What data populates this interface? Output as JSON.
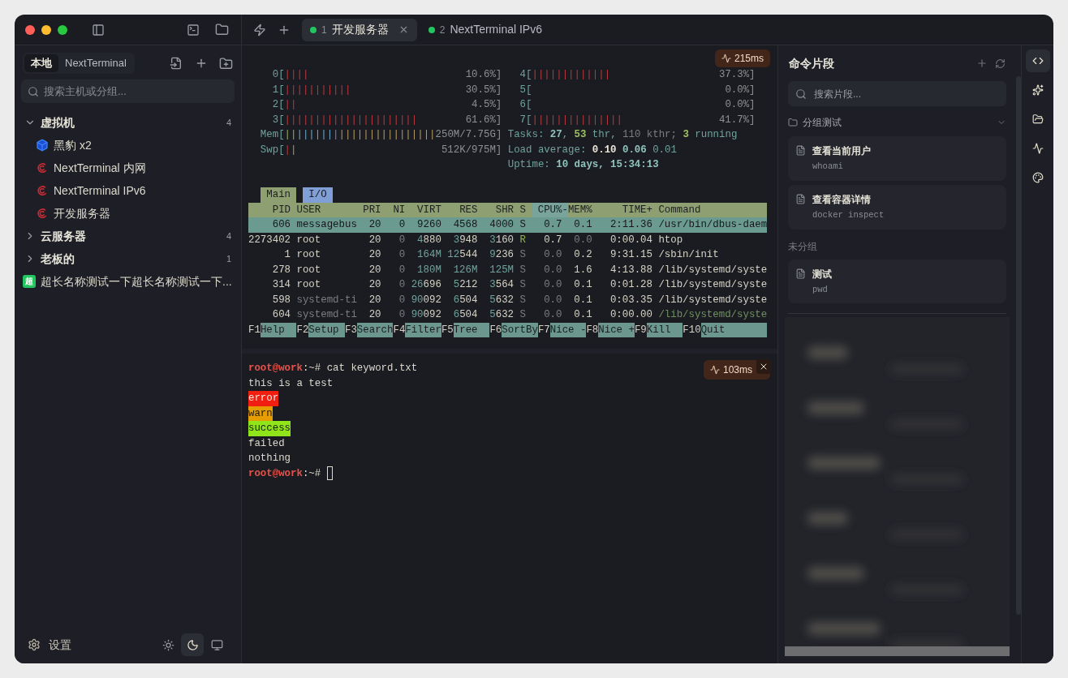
{
  "titlebar": {
    "tabs": [
      {
        "number": "1",
        "title": "开发服务器",
        "selected": true,
        "connected": true
      },
      {
        "number": "2",
        "title": "NextTerminal IPv6",
        "selected": false,
        "connected": true
      }
    ]
  },
  "sidebar": {
    "tabs": [
      {
        "label": "本地",
        "selected": true
      },
      {
        "label": "NextTerminal",
        "selected": false
      }
    ],
    "search": {
      "placeholder": "搜索主机或分组..."
    },
    "items": [
      {
        "kind": "group",
        "name": "虚拟机",
        "count": "4",
        "expanded": true,
        "children": [
          {
            "kind": "cube",
            "name": "黑豹 x2"
          },
          {
            "kind": "debian",
            "name": "NextTerminal 内网"
          },
          {
            "kind": "debian",
            "name": "NextTerminal IPv6"
          },
          {
            "kind": "debian",
            "name": "开发服务器"
          }
        ]
      },
      {
        "kind": "group",
        "name": "云服务器",
        "count": "4",
        "expanded": false
      },
      {
        "kind": "group",
        "name": "老板的",
        "count": "1",
        "expanded": false
      },
      {
        "kind": "badge",
        "badge": "超",
        "name": "超长名称测试一下超长名称测试一下..."
      }
    ],
    "settings": "设置",
    "themes": [
      {
        "kind": "light",
        "selected": false
      },
      {
        "kind": "dark",
        "selected": true
      },
      {
        "kind": "system",
        "selected": false
      }
    ]
  },
  "htop": {
    "latency": "215ms",
    "meters": [
      {
        "left": {
          "label": "0[",
          "bars": [
            {
              "text": "||||",
              "kind": "r"
            }
          ],
          "value": "10.6%]"
        },
        "right": {
          "label": "4[",
          "bars": [
            {
              "text": "|||||||||||||",
              "kind": "r"
            }
          ],
          "value": "37.3%]"
        }
      },
      {
        "left": {
          "label": "1[",
          "bars": [
            {
              "text": "|||||||||||",
              "kind": "r"
            }
          ],
          "value": "30.5%]"
        },
        "right": {
          "label": "5[",
          "value": "0.0%]"
        }
      },
      {
        "left": {
          "label": "2[",
          "bars": [
            {
              "text": "||",
              "kind": "r"
            }
          ],
          "value": "4.5%]"
        },
        "right": {
          "label": "6[",
          "value": "0.0%]"
        }
      },
      {
        "left": {
          "label": "3[",
          "bars": [
            {
              "text": "||||||||||||||||||||||",
              "kind": "r"
            }
          ],
          "value": "61.6%]"
        },
        "right": {
          "label": "7[",
          "bars": [
            {
              "text": "|||||||||||||||",
              "kind": "r"
            }
          ],
          "value": "41.7%]"
        }
      },
      {
        "left": {
          "label": "Mem[",
          "bars": [
            {
              "text": "||",
              "kind": "g"
            },
            {
              "text": "||||||",
              "kind": "bl"
            },
            {
              "text": "|",
              "kind": "p"
            },
            {
              "text": "||||||||||||||||",
              "kind": "y"
            }
          ],
          "value": "250M/7.75G]"
        },
        "info": [
          {
            "text": "Tasks: ",
            "kind": "t"
          },
          {
            "text": "27",
            "kind": "tb"
          },
          {
            "text": ", ",
            "kind": "t"
          },
          {
            "text": "53",
            "kind": "gb"
          },
          {
            "text": " thr, ",
            "kind": "t"
          },
          {
            "text": "110",
            "kind": "d"
          },
          {
            "text": " kthr; ",
            "kind": "d"
          },
          {
            "text": "3",
            "kind": "gb"
          },
          {
            "text": " running",
            "kind": "t"
          }
        ]
      },
      {
        "left": {
          "label": "Swp[",
          "bars": [
            {
              "text": "|",
              "kind": "r"
            },
            {
              "text": "|",
              "kind": "y"
            }
          ],
          "value": "512K/975M]"
        },
        "info": [
          {
            "text": "Load average: ",
            "kind": "t"
          },
          {
            "text": "0.10",
            "kind": "w"
          },
          {
            "text": " 0.06",
            "kind": "tb"
          },
          {
            "text": " 0.01",
            "kind": "t"
          }
        ]
      },
      {
        "info": [
          {
            "text": "Uptime: ",
            "kind": "t"
          },
          {
            "text": "10 days, 15:34:13",
            "kind": "tb"
          }
        ]
      }
    ],
    "tabs": [
      {
        "label": "Main",
        "selected": true
      },
      {
        "label": "I/O",
        "selected": false
      }
    ],
    "columns": [
      {
        "label": "PID",
        "sorted": false
      },
      {
        "label": "USER",
        "sorted": false
      },
      {
        "label": "PRI",
        "sorted": false
      },
      {
        "label": "NI",
        "sorted": false
      },
      {
        "label": "VIRT",
        "sorted": false
      },
      {
        "label": "RES",
        "sorted": false
      },
      {
        "label": "SHR",
        "sorted": false
      },
      {
        "label": "S",
        "sorted": false
      },
      {
        "label": "CPU%-",
        "sorted": true
      },
      {
        "label": "MEM%",
        "sorted": false
      },
      {
        "label": "TIME+",
        "sorted": false
      },
      {
        "label": "Command",
        "sorted": false
      }
    ],
    "rows": [
      {
        "selected": true,
        "cells": [
          "606",
          "messagebus",
          "20",
          "0",
          "9260",
          "4568",
          "4000",
          "S",
          "0.7",
          "0.1",
          "2:11.36",
          "/usr/bin/dbus-daem"
        ]
      },
      {
        "selected": false,
        "cells": [
          "2273402",
          "root",
          "20",
          [
            {
              "text": "0",
              "kind": "d"
            }
          ],
          [
            {
              "text": "4",
              "kind": "t"
            },
            {
              "text": "880",
              "kind": "n"
            }
          ],
          [
            {
              "text": "3",
              "kind": "t"
            },
            {
              "text": "948",
              "kind": "n"
            }
          ],
          [
            {
              "text": "3",
              "kind": "t"
            },
            {
              "text": "160",
              "kind": "n"
            }
          ],
          [
            {
              "text": "R",
              "kind": "g"
            }
          ],
          "0.7",
          [
            {
              "text": "0.0",
              "kind": "d"
            }
          ],
          "0:00.04",
          "htop"
        ]
      },
      {
        "selected": false,
        "cells": [
          "1",
          "root",
          "20",
          [
            {
              "text": "0",
              "kind": "d"
            }
          ],
          [
            {
              "text": "164M",
              "kind": "t"
            }
          ],
          [
            {
              "text": "12",
              "kind": "t"
            },
            {
              "text": "544",
              "kind": "n"
            }
          ],
          [
            {
              "text": "9",
              "kind": "t"
            },
            {
              "text": "236",
              "kind": "n"
            }
          ],
          [
            {
              "text": "S",
              "kind": "d"
            }
          ],
          [
            {
              "text": "0.0",
              "kind": "d"
            }
          ],
          "0.2",
          "9:31.15",
          "/sbin/init"
        ]
      },
      {
        "selected": false,
        "cells": [
          "278",
          "root",
          "20",
          [
            {
              "text": "0",
              "kind": "d"
            }
          ],
          [
            {
              "text": "180M",
              "kind": "t"
            }
          ],
          [
            {
              "text": "126M",
              "kind": "t"
            }
          ],
          [
            {
              "text": "125M",
              "kind": "t"
            }
          ],
          [
            {
              "text": "S",
              "kind": "d"
            }
          ],
          [
            {
              "text": "0.0",
              "kind": "d"
            }
          ],
          "1.6",
          "4:13.88",
          "/lib/systemd/syste"
        ]
      },
      {
        "selected": false,
        "cells": [
          "314",
          "root",
          "20",
          [
            {
              "text": "0",
              "kind": "d"
            }
          ],
          [
            {
              "text": "26",
              "kind": "t"
            },
            {
              "text": "696",
              "kind": "n"
            }
          ],
          [
            {
              "text": "5",
              "kind": "t"
            },
            {
              "text": "212",
              "kind": "n"
            }
          ],
          [
            {
              "text": "3",
              "kind": "t"
            },
            {
              "text": "564",
              "kind": "n"
            }
          ],
          [
            {
              "text": "S",
              "kind": "d"
            }
          ],
          [
            {
              "text": "0.0",
              "kind": "d"
            }
          ],
          "0.1",
          "0:01.28",
          "/lib/systemd/syste"
        ]
      },
      {
        "selected": false,
        "cells": [
          "598",
          [
            {
              "text": "systemd-ti",
              "kind": "d"
            }
          ],
          "20",
          [
            {
              "text": "0",
              "kind": "d"
            }
          ],
          [
            {
              "text": "90",
              "kind": "t"
            },
            {
              "text": "092",
              "kind": "n"
            }
          ],
          [
            {
              "text": "6",
              "kind": "t"
            },
            {
              "text": "504",
              "kind": "n"
            }
          ],
          [
            {
              "text": "5",
              "kind": "t"
            },
            {
              "text": "632",
              "kind": "n"
            }
          ],
          [
            {
              "text": "S",
              "kind": "d"
            }
          ],
          [
            {
              "text": "0.0",
              "kind": "d"
            }
          ],
          "0.1",
          "0:03.35",
          "/lib/systemd/syste"
        ]
      },
      {
        "selected": false,
        "cells": [
          "604",
          [
            {
              "text": "systemd-ti",
              "kind": "d"
            }
          ],
          "20",
          [
            {
              "text": "0",
              "kind": "d"
            }
          ],
          [
            {
              "text": "90",
              "kind": "t"
            },
            {
              "text": "092",
              "kind": "n"
            }
          ],
          [
            {
              "text": "6",
              "kind": "t"
            },
            {
              "text": "504",
              "kind": "n"
            }
          ],
          [
            {
              "text": "5",
              "kind": "t"
            },
            {
              "text": "632",
              "kind": "n"
            }
          ],
          [
            {
              "text": "S",
              "kind": "d"
            }
          ],
          [
            {
              "text": "0.0",
              "kind": "d"
            }
          ],
          "0.1",
          "0:00.00",
          [
            {
              "text": "/lib/systemd/syste",
              "kind": "dg"
            }
          ]
        ]
      }
    ],
    "function_keys": [
      {
        "key": "F1",
        "label": "Help"
      },
      {
        "key": "F2",
        "label": "Setup"
      },
      {
        "key": "F3",
        "label": "Search"
      },
      {
        "key": "F4",
        "label": "Filter"
      },
      {
        "key": "F5",
        "label": "Tree"
      },
      {
        "key": "F6",
        "label": "SortBy"
      },
      {
        "key": "F7",
        "label": "Nice -"
      },
      {
        "key": "F8",
        "label": "Nice +"
      },
      {
        "key": "F9",
        "label": "Kill"
      },
      {
        "key": "F10",
        "label": "Quit"
      }
    ]
  },
  "terminal": {
    "latency": "103ms",
    "lines": [
      {
        "segments": [
          {
            "text": "root@work",
            "kind": "user"
          },
          {
            "text": ":~# cat keyword.txt",
            "kind": "out"
          }
        ]
      },
      {
        "segments": [
          {
            "text": "this is a test",
            "kind": "out"
          }
        ]
      },
      {
        "segments": [
          {
            "text": "error",
            "kind": "error"
          }
        ]
      },
      {
        "segments": [
          {
            "text": "warn",
            "kind": "warn"
          }
        ]
      },
      {
        "segments": [
          {
            "text": "success",
            "kind": "success"
          }
        ]
      },
      {
        "segments": [
          {
            "text": "failed",
            "kind": "out"
          }
        ]
      },
      {
        "segments": [
          {
            "text": "nothing",
            "kind": "out"
          }
        ]
      },
      {
        "segments": [
          {
            "text": "root@work",
            "kind": "user"
          },
          {
            "text": ":~# ",
            "kind": "out"
          }
        ],
        "cursor": true
      }
    ]
  },
  "snippets": {
    "title": "命令片段",
    "search": {
      "placeholder": "搜索片段..."
    },
    "groups": [
      {
        "name": "分组测试",
        "expanded": true,
        "items": [
          {
            "title": "查看当前用户",
            "command": "whoami"
          },
          {
            "title": "查看容器详情",
            "command": "docker inspect"
          }
        ]
      }
    ],
    "ungrouped_label": "未分组",
    "ungrouped": [
      {
        "title": "测试",
        "command": "pwd"
      }
    ]
  },
  "rail": [
    {
      "kind": "code",
      "selected": true
    },
    {
      "kind": "sparkles",
      "selected": false
    },
    {
      "kind": "folder",
      "selected": false
    },
    {
      "kind": "activity",
      "selected": false
    },
    {
      "kind": "palette",
      "selected": false
    }
  ]
}
